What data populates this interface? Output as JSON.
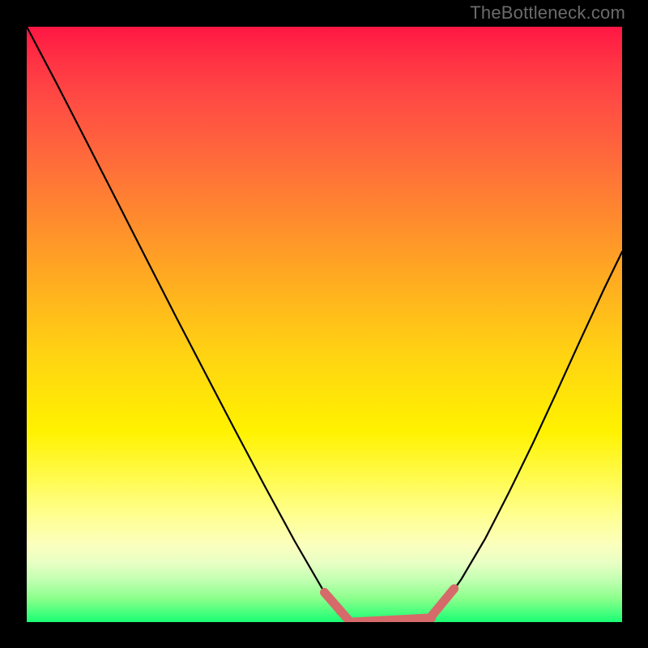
{
  "watermark": "TheBottleneck.com",
  "colors": {
    "frame": "#000000",
    "curve": "#000000",
    "highlight": "#d66a6a"
  },
  "chart_data": {
    "type": "line",
    "title": "",
    "xlabel": "",
    "ylabel": "",
    "xlim": [
      0,
      1
    ],
    "ylim": [
      0,
      1
    ],
    "series": [
      {
        "name": "curve",
        "x": [
          0.0,
          0.05,
          0.1,
          0.15,
          0.2,
          0.25,
          0.3,
          0.35,
          0.4,
          0.45,
          0.5,
          0.523,
          0.55,
          0.58,
          0.62,
          0.65,
          0.68,
          0.7,
          0.73,
          0.77,
          0.81,
          0.85,
          0.89,
          0.93,
          0.97,
          1.0
        ],
        "y": [
          1.0,
          0.905,
          0.808,
          0.71,
          0.612,
          0.514,
          0.418,
          0.322,
          0.228,
          0.136,
          0.05,
          0.014,
          0.0,
          0.0,
          0.0,
          0.0,
          0.01,
          0.03,
          0.072,
          0.14,
          0.218,
          0.3,
          0.386,
          0.474,
          0.56,
          0.622
        ]
      }
    ],
    "highlight_segments": [
      {
        "x": [
          0.5,
          0.54
        ],
        "y": [
          0.05,
          0.004
        ]
      },
      {
        "x": [
          0.545,
          0.68
        ],
        "y": [
          0.0,
          0.007
        ]
      },
      {
        "x": [
          0.68,
          0.718
        ],
        "y": [
          0.01,
          0.056
        ]
      }
    ]
  }
}
